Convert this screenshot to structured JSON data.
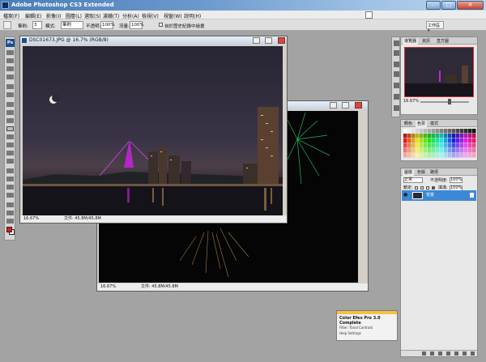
{
  "window": {
    "title": "Adobe Photoshop CS3 Extended"
  },
  "menu": [
    "檔案(F)",
    "編輯(E)",
    "影像(I)",
    "圖層(L)",
    "選取(S)",
    "濾鏡(T)",
    "分析(A)",
    "檢視(V)",
    "視窗(W)",
    "說明(H)"
  ],
  "options_bar": {
    "brush_label": "筆刷:",
    "brush_size": "3",
    "mode_label": "模式:",
    "mode_value": "筆刷",
    "opacity_label": "不透明:",
    "opacity_value": "100%",
    "flow_label": "流量:",
    "flow_value": "100%",
    "checkbox_label": "自於歷史紀錄中繪畫",
    "workspace_label": "工作區 ▾"
  },
  "toolbox": {
    "logo": "Ps"
  },
  "doc_front": {
    "title": "DSC01673.JPG @ 16.7% (RGB/8)",
    "zoom": "16.67%",
    "status": "文件: 45.8M/45.8M"
  },
  "doc_back": {
    "zoom": "16.67%",
    "status": "文件: 45.8M/45.8M"
  },
  "navigator": {
    "tabs": [
      "導覽器",
      "資訊",
      "直方圖"
    ],
    "zoom": "16.67%"
  },
  "swatches": {
    "tabs": [
      "顏色",
      "色票",
      "樣式"
    ]
  },
  "layers": {
    "tabs": [
      "圖層",
      "色版",
      "路徑"
    ],
    "blend_mode": "正常",
    "opacity_label": "不透明度:",
    "opacity_value": "100%",
    "lock_label": "鎖定:",
    "fill_label": "填滿:",
    "fill_value": "100%",
    "layer_name": "背景"
  },
  "plugin": {
    "title": "Color Efex Pro 3.0 Complete",
    "line1": "Filter: Tonal Contrast",
    "line2": "Help   Settings"
  }
}
